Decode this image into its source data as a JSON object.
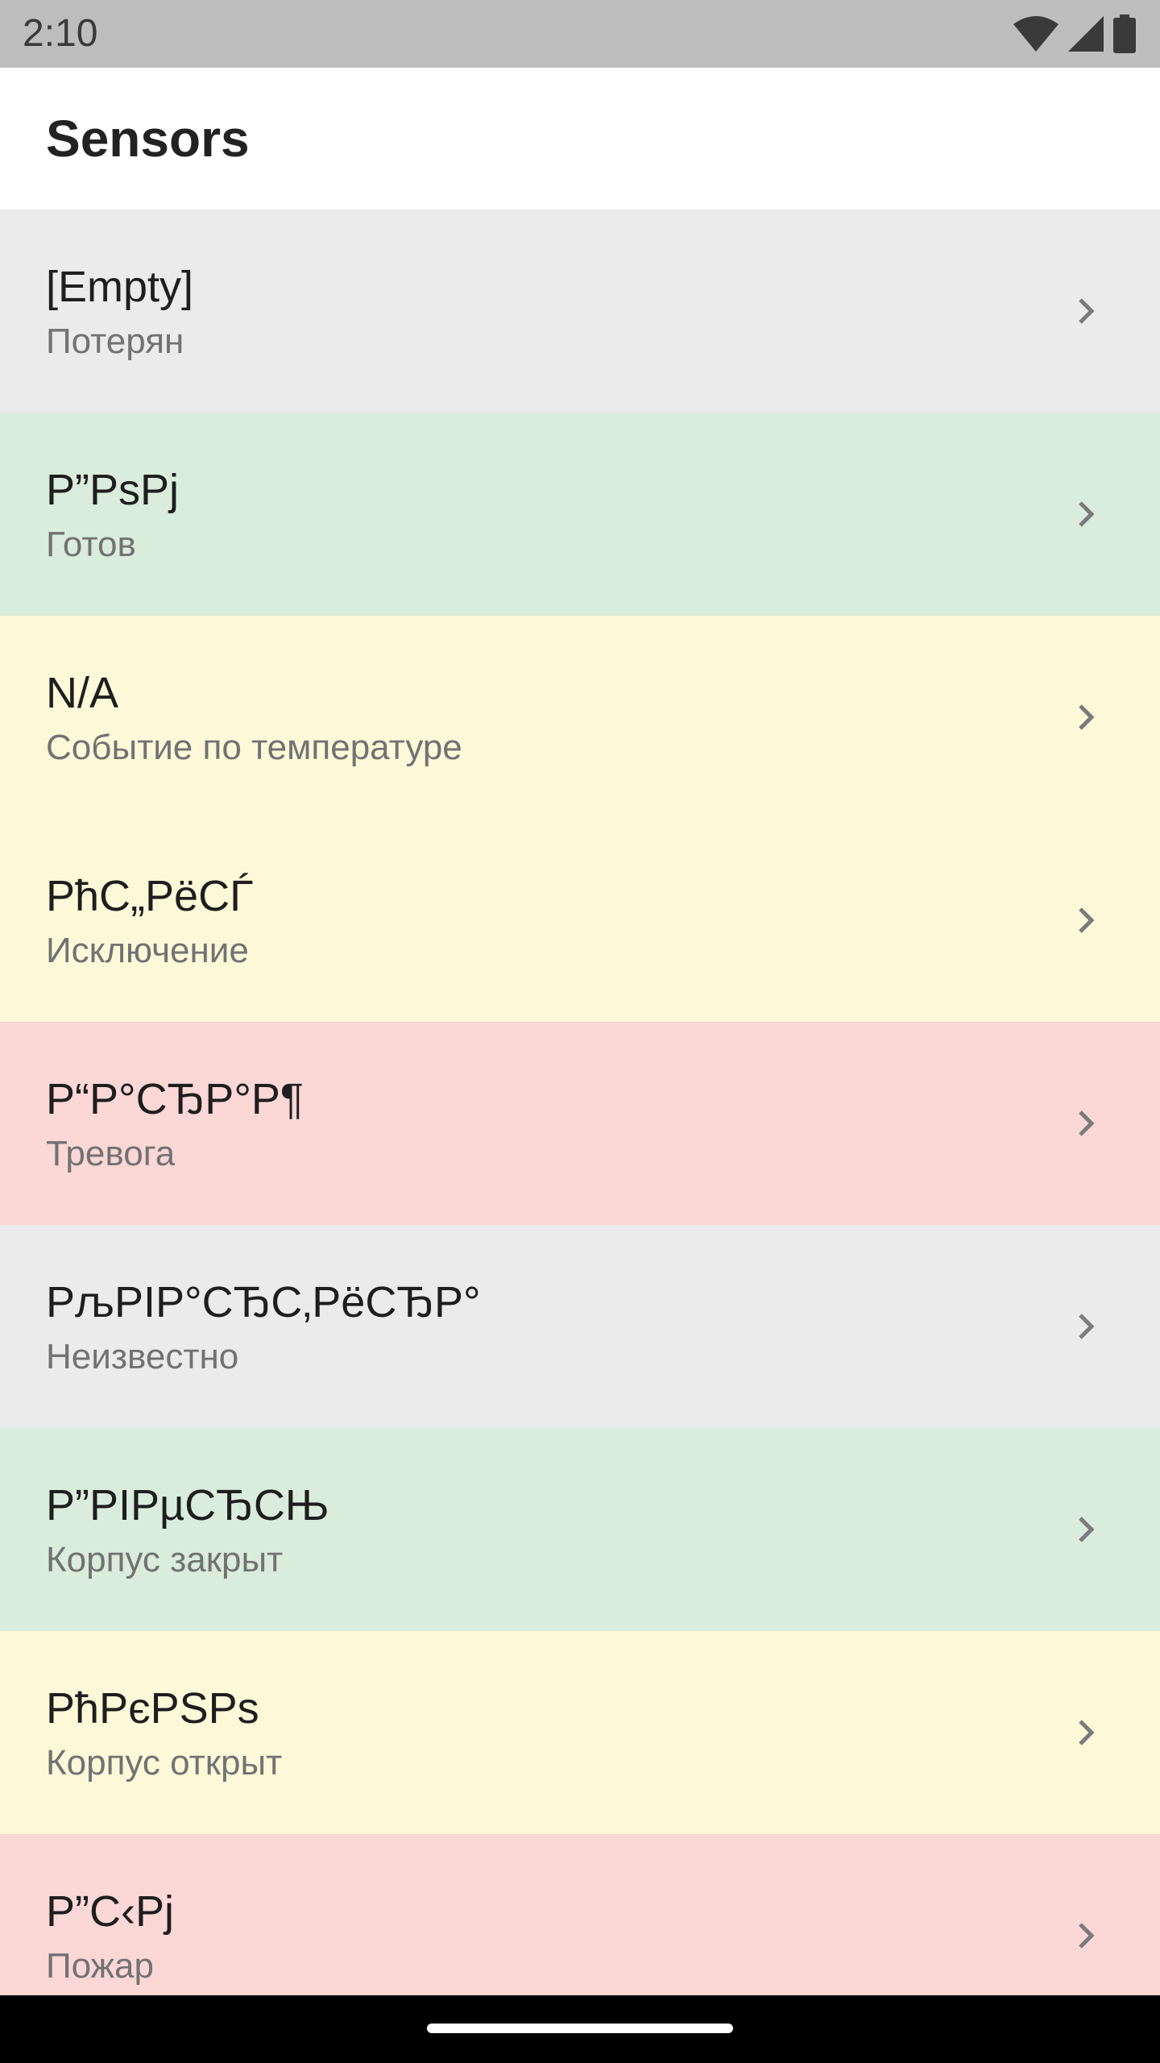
{
  "status_bar": {
    "time": "2:10",
    "icons": [
      "wifi-icon",
      "cellular-signal-icon",
      "battery-icon"
    ]
  },
  "app_bar": {
    "title": "Sensors"
  },
  "colors": {
    "gray": "#ebebeb",
    "green": "#daecdb",
    "yellow": "#fdf8d8",
    "red": "#fbd7d6"
  },
  "sensors": [
    {
      "title": "[Empty]",
      "status": "Потерян",
      "color": "#ebebeb"
    },
    {
      "title": "Р”РѕРј",
      "status": "Готов",
      "color": "#daecdb"
    },
    {
      "title": "N/A",
      "status": "Событие по температуре",
      "color": "#fdf8d8"
    },
    {
      "title": "РћС„РёСЃ",
      "status": "Исключение",
      "color": "#fdf8d8"
    },
    {
      "title": "Р“Р°СЂР°Р¶",
      "status": "Тревога",
      "color": "#fbd7d6"
    },
    {
      "title": "РљРІР°СЂС‚РёСЂР°",
      "status": "Неизвестно",
      "color": "#ebebeb"
    },
    {
      "title": "Р”РІРµСЂСЊ",
      "status": "Корпус закрыт",
      "color": "#daecdb"
    },
    {
      "title": "РћРєРЅРѕ",
      "status": "Корпус открыт",
      "color": "#fdf8d8"
    },
    {
      "title": "Р”С‹Рј",
      "status": "Пожар",
      "color": "#fbd7d6"
    }
  ]
}
